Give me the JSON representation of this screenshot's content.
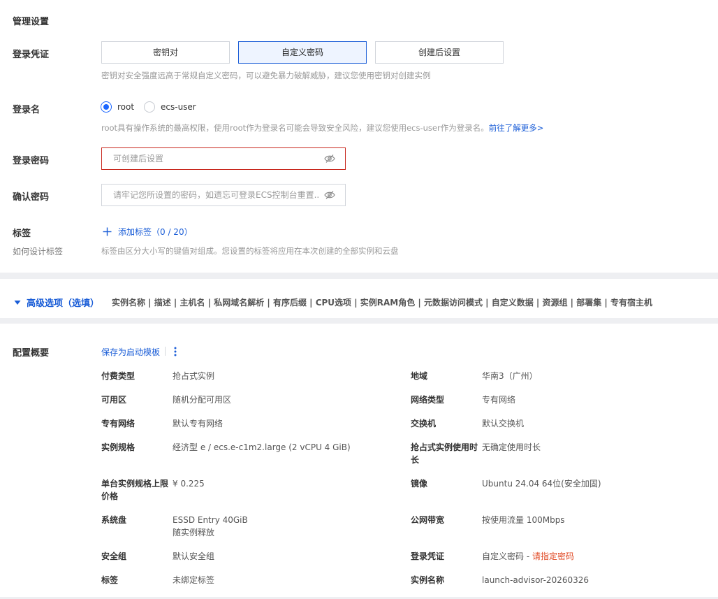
{
  "management": {
    "section_title": "管理设置",
    "credential": {
      "label": "登录凭证",
      "options": [
        "密钥对",
        "自定义密码",
        "创建后设置"
      ],
      "selected": "自定义密码",
      "hint": "密钥对安全强度远高于常规自定义密码，可以避免暴力破解威胁，建议您使用密钥对创建实例"
    },
    "login_name": {
      "label": "登录名",
      "options": [
        "root",
        "ecs-user"
      ],
      "selected": "root",
      "hint": "root具有操作系统的最高权限，使用root作为登录名可能会导致安全风险，建议您使用ecs-user作为登录名。",
      "hint_link": "前往了解更多>"
    },
    "password": {
      "label": "登录密码",
      "value": "",
      "placeholder": "可创建后设置",
      "icon": "eye-off-icon"
    },
    "confirm_password": {
      "label": "确认密码",
      "value": "",
      "placeholder": "请牢记您所设置的密码，如遗忘可登录ECS控制台重置...",
      "icon": "eye-off-icon"
    },
    "tags": {
      "label": "标签",
      "sub_label": "如何设计标签",
      "add_label": "添加标签（0 / 20）",
      "hint": "标签由区分大小写的键值对组成。您设置的标签将应用在本次创建的全部实例和云盘"
    }
  },
  "advanced": {
    "title": "高级选项（选填）",
    "items": "实例名称 | 描述 | 主机名 | 私网域名解析 | 有序后缀 | CPU选项 | 实例RAM角色 | 元数据访问模式 | 自定义数据 | 资源组 | 部署集 | 专有宿主机"
  },
  "summary": {
    "title": "配置概要",
    "save_template": "保存为启动模板",
    "rows": [
      {
        "label": "付费类型",
        "value": "抢占式实例"
      },
      {
        "label": "地域",
        "value": "华南3（广州）"
      },
      {
        "label": "可用区",
        "value": "随机分配可用区"
      },
      {
        "label": "网络类型",
        "value": "专有网络"
      },
      {
        "label": "专有网络",
        "value": "默认专有网络"
      },
      {
        "label": "交换机",
        "value": "默认交换机"
      },
      {
        "label": "实例规格",
        "value": "经济型 e / ecs.e-c1m2.large (2 vCPU 4 GiB)"
      },
      {
        "label": "抢占式实例使用时长",
        "value": "无确定使用时长"
      },
      {
        "label": "单台实例规格上限价格",
        "value": "¥ 0.225"
      },
      {
        "label": "镜像",
        "value": "Ubuntu 24.04 64位(安全加固)"
      },
      {
        "label": "系统盘",
        "value": "ESSD Entry 40GiB",
        "value2": "随实例释放"
      },
      {
        "label": "公网带宽",
        "value": "按使用流量 100Mbps"
      },
      {
        "label": "安全组",
        "value": "默认安全组"
      },
      {
        "label": "登录凭证",
        "value": "自定义密码 - ",
        "warning": "请指定密码"
      },
      {
        "label": "标签",
        "value": "未绑定标签"
      },
      {
        "label": "实例名称",
        "value": "launch-advisor-20260326"
      }
    ]
  },
  "colors": {
    "accent": "#1a5dd7",
    "error_border": "#c8281e",
    "warning_text": "#e0451f"
  }
}
